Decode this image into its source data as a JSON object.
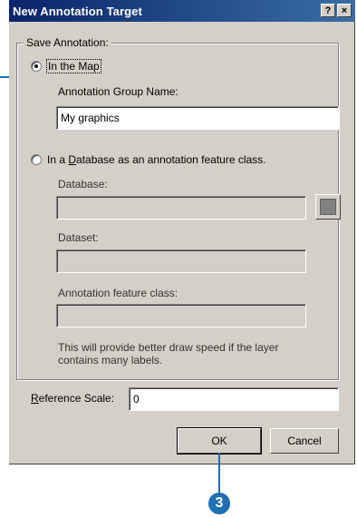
{
  "titlebar": {
    "title": "New Annotation Target",
    "help_glyph": "?",
    "close_glyph": "×"
  },
  "group": {
    "legend": "Save Annotation:"
  },
  "in_the_map": {
    "radio_label": "In the Map",
    "checked": true,
    "group_name_label": "Annotation Group Name:",
    "group_name_value": "My graphics"
  },
  "in_database": {
    "radio_label": "In a Database as an annotation feature class.",
    "checked": false,
    "database_label": "Database:",
    "database_value": "",
    "dataset_label": "Dataset:",
    "dataset_value": "",
    "feature_class_label": "Annotation feature class:",
    "feature_class_value": "",
    "note_line1": "This will provide better draw speed if the layer",
    "note_line2": "contains many labels."
  },
  "reference_scale": {
    "label": "Reference Scale:",
    "value": "0"
  },
  "buttons": {
    "ok": "OK",
    "cancel": "Cancel"
  },
  "callout": {
    "step": "3"
  },
  "colors": {
    "title_bar": "#0a246a",
    "dialog_face": "#d4d0c8",
    "callout": "#1f6fb2"
  }
}
